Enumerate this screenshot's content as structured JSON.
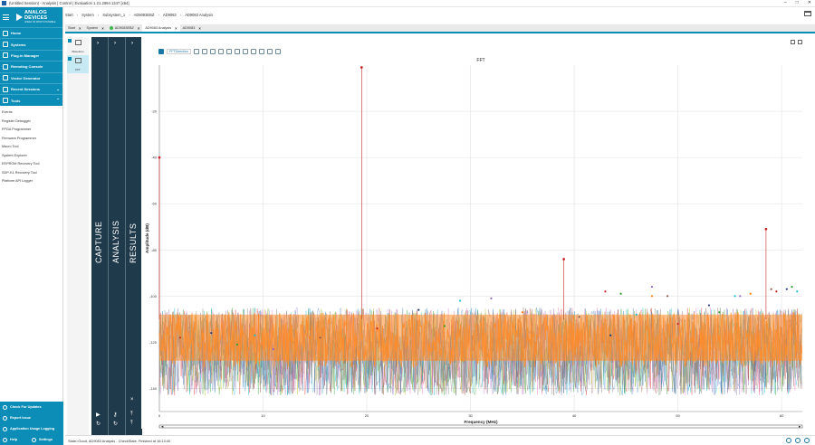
{
  "window": {
    "title": "(Untitled Session) - Analysis | Control | Evaluation 1.21.2994.1347 [x64]"
  },
  "sidebar": {
    "logo_line1": "ANALOG",
    "logo_line2": "DEVICES",
    "logo_tag": "AHEAD OF WHAT'S POSSIBLE",
    "items": [
      {
        "label": "Home"
      },
      {
        "label": "Systems"
      },
      {
        "label": "Plug-in Manager"
      },
      {
        "label": "Remoting Console"
      },
      {
        "label": "Vector Generator"
      },
      {
        "label": "Recent Sessions"
      },
      {
        "label": "Tools"
      }
    ],
    "tools": [
      "Events",
      "Register Debugger",
      "FPGA Programmer",
      "Firmware Programmer",
      "Macro Tool",
      "System Explorer",
      "EEPROM Recovery Tool",
      "SDP-K1 Recovery Tool",
      "Platform API Logger"
    ],
    "footer": {
      "check_updates": "Check For Updates",
      "report_issue": "Report Issue",
      "usage_logging": "Application Usage Logging",
      "help": "Help",
      "settings": "Settings"
    }
  },
  "breadcrumb": [
    "Start",
    "System",
    "Subsystem_1",
    "AD9083EBZ",
    "AD9083",
    "AD9083 Analysis"
  ],
  "tabs": [
    {
      "label": "Start"
    },
    {
      "label": "System"
    },
    {
      "label": "AD9083EBZ"
    },
    {
      "label": "AD9083 Analysis"
    },
    {
      "label": "AD9083"
    }
  ],
  "toolpanel": {
    "waveform": "Waveform",
    "fft": "FFT"
  },
  "panels": {
    "capture": "CAPTURE",
    "analysis": "ANALYSIS",
    "results": "RESULTS"
  },
  "plot_toolbar": {
    "fft_direction": "FFTDirection"
  },
  "colors": {
    "accent": "#0b8db7",
    "dark_panel": "#1f3a4a",
    "noise_fill": "#ff8c2a"
  },
  "chart_data": {
    "type": "line",
    "title": "FFT",
    "xlabel": "Frequency (MHz)",
    "ylabel": "Amplitude (dB)",
    "xlim": [
      0,
      62
    ],
    "ylim": [
      -150,
      0
    ],
    "xticks": [
      0,
      10,
      20,
      30,
      40,
      50,
      60
    ],
    "yticks": [
      -20,
      -40,
      -60,
      -80,
      -100,
      -120,
      -140
    ],
    "grid": true,
    "noise_floor_band": [
      -145,
      -105
    ],
    "spurs": [
      {
        "x": 19.5,
        "y": -1
      },
      {
        "x": 39,
        "y": -84
      },
      {
        "x": 58.5,
        "y": -71
      },
      {
        "x": 0,
        "y": -40
      }
    ],
    "markers": [
      {
        "x": 2,
        "y": -118
      },
      {
        "x": 5,
        "y": -116
      },
      {
        "x": 7.5,
        "y": -121
      },
      {
        "x": 9.2,
        "y": -117
      },
      {
        "x": 11,
        "y": -123
      },
      {
        "x": 14.5,
        "y": -118
      },
      {
        "x": 15.5,
        "y": -118
      },
      {
        "x": 21,
        "y": -114
      },
      {
        "x": 25,
        "y": -106
      },
      {
        "x": 27.5,
        "y": -113
      },
      {
        "x": 29,
        "y": -102
      },
      {
        "x": 32,
        "y": -101
      },
      {
        "x": 35,
        "y": -107
      },
      {
        "x": 40.5,
        "y": -109
      },
      {
        "x": 43,
        "y": -98
      },
      {
        "x": 43.5,
        "y": -117
      },
      {
        "x": 44.5,
        "y": -99
      },
      {
        "x": 46,
        "y": -108
      },
      {
        "x": 47.5,
        "y": -96
      },
      {
        "x": 47.5,
        "y": -100
      },
      {
        "x": 49,
        "y": -100
      },
      {
        "x": 50,
        "y": -112
      },
      {
        "x": 53,
        "y": -104
      },
      {
        "x": 54,
        "y": -107
      },
      {
        "x": 55.5,
        "y": -100
      },
      {
        "x": 56,
        "y": -100
      },
      {
        "x": 57,
        "y": -99
      },
      {
        "x": 59,
        "y": -97
      },
      {
        "x": 59.5,
        "y": -98
      },
      {
        "x": 60.5,
        "y": -97
      },
      {
        "x": 61,
        "y": -96
      },
      {
        "x": 61.5,
        "y": -98
      }
    ]
  },
  "status": {
    "text": "State=Good, AD9083 Analysis - CheckState, Finished at 16:13:40"
  }
}
